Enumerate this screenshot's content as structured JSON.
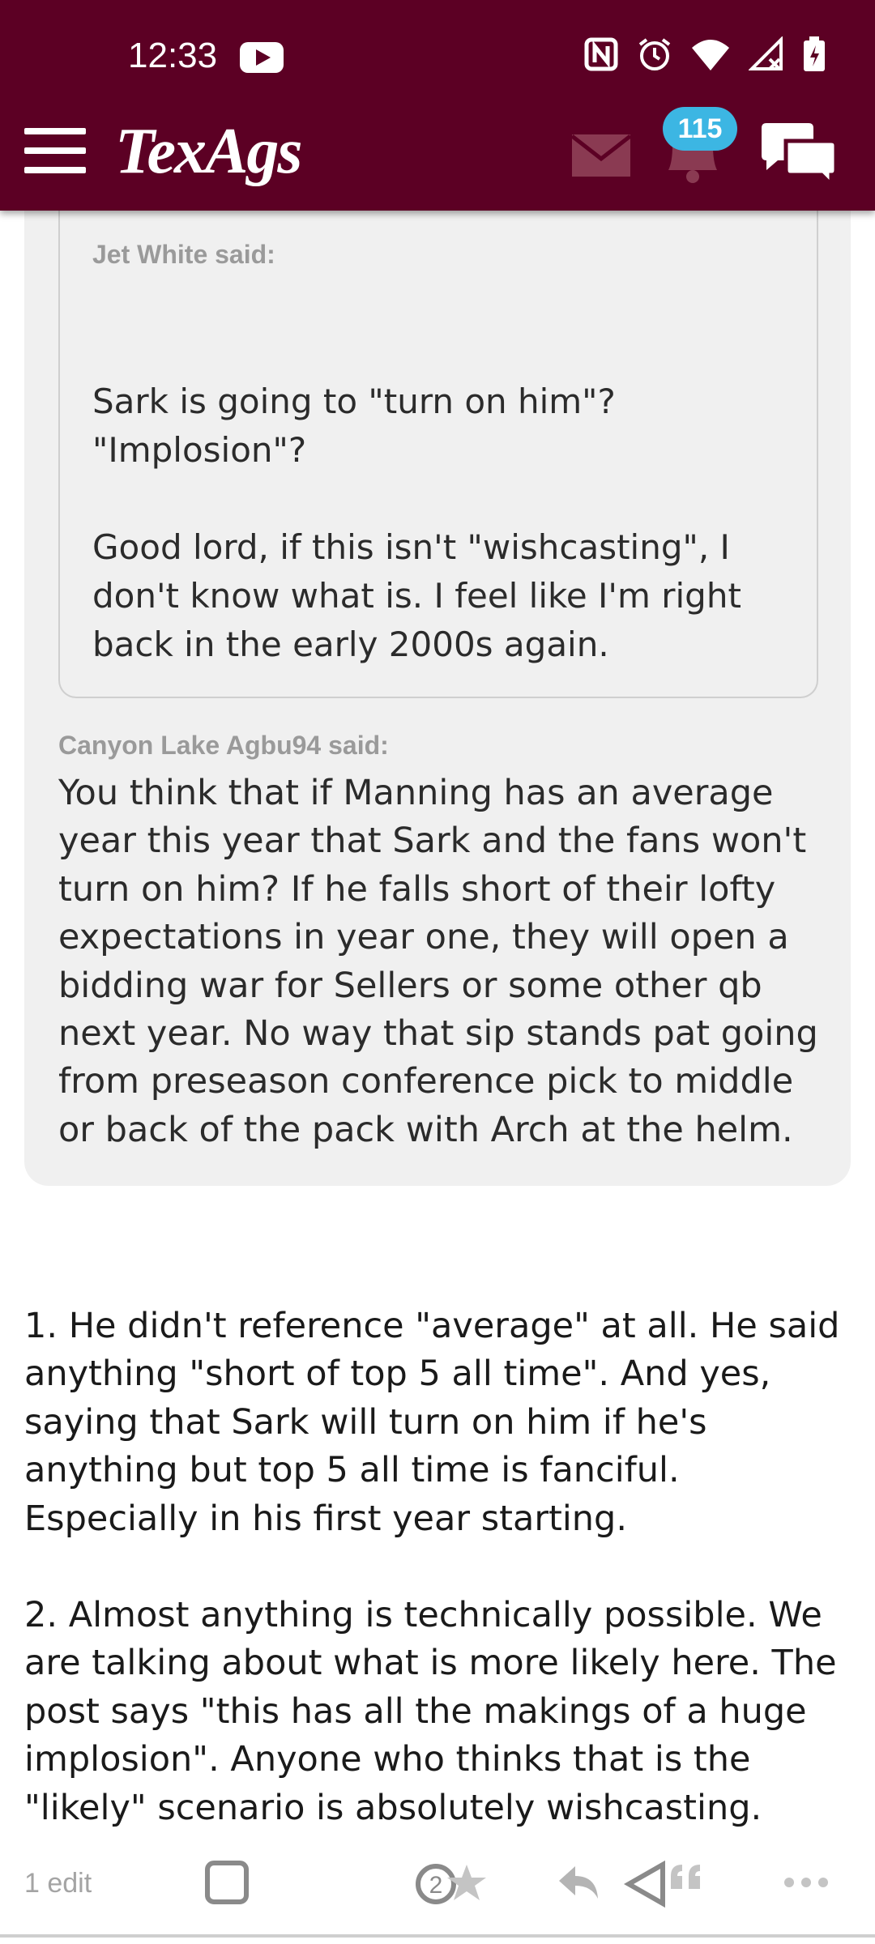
{
  "status_bar": {
    "time": "12:33"
  },
  "header": {
    "brand": "TexAgs",
    "notification_count": "115"
  },
  "quote_inner": {
    "author_line": "Jet White said:",
    "paragraphs": [
      "Sark is going to \"turn on him\"? \"Implosion\"?",
      "Good lord, if this isn't \"wishcasting\", I don't know what is. I feel like I'm right back in the early 2000s again."
    ]
  },
  "quote_outer": {
    "author_line": "Canyon Lake Agbu94 said:",
    "text": "You think that if Manning has an average year this year that Sark and the fans won't turn on him? If he falls short of their lofty expectations in year one, they will open a bidding war for Sellers or some other qb next year. No way that sip stands pat going from preseason conference pick to middle or back of the pack with Arch at the helm."
  },
  "post": {
    "paragraphs": [
      "1. He didn't reference \"average\" at all. He said anything \"short of top 5 all time\". And yes, saying that Sark will turn on him if he's anything but top 5 all time is fanciful. Especially in his first year starting.",
      "2. Almost anything is technically possible. We are talking about what is more likely here. The post says \"this has all the makings of a huge implosion\". Anyone who thinks that is the \"likely\" scenario is absolutely wishcasting."
    ],
    "edit_label": "1 edit",
    "star_count": "2"
  }
}
